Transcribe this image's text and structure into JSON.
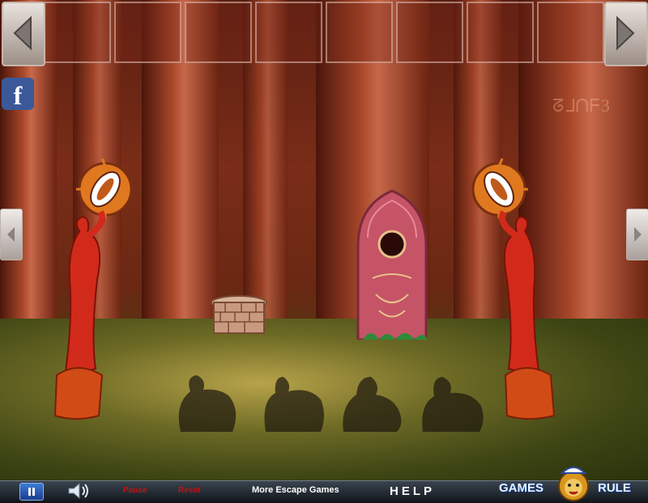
{
  "game": {
    "inventory_slots": 8,
    "scene_code": "ᘔ⅃ᑎᖴ3",
    "colors": {
      "accent": "#c21212",
      "bar": "#1d242c"
    }
  },
  "bottom_bar": {
    "label_red_1": "Pause",
    "label_red_2": "Reset",
    "more_games": "More Escape Games",
    "help": "HELP"
  },
  "logo": {
    "left": "GAMES",
    "right": "RULE"
  },
  "icons": {
    "facebook": "f",
    "nav_left": "left-arrow",
    "nav_right": "right-arrow",
    "pause": "pause-icon",
    "sound": "speaker-icon"
  }
}
